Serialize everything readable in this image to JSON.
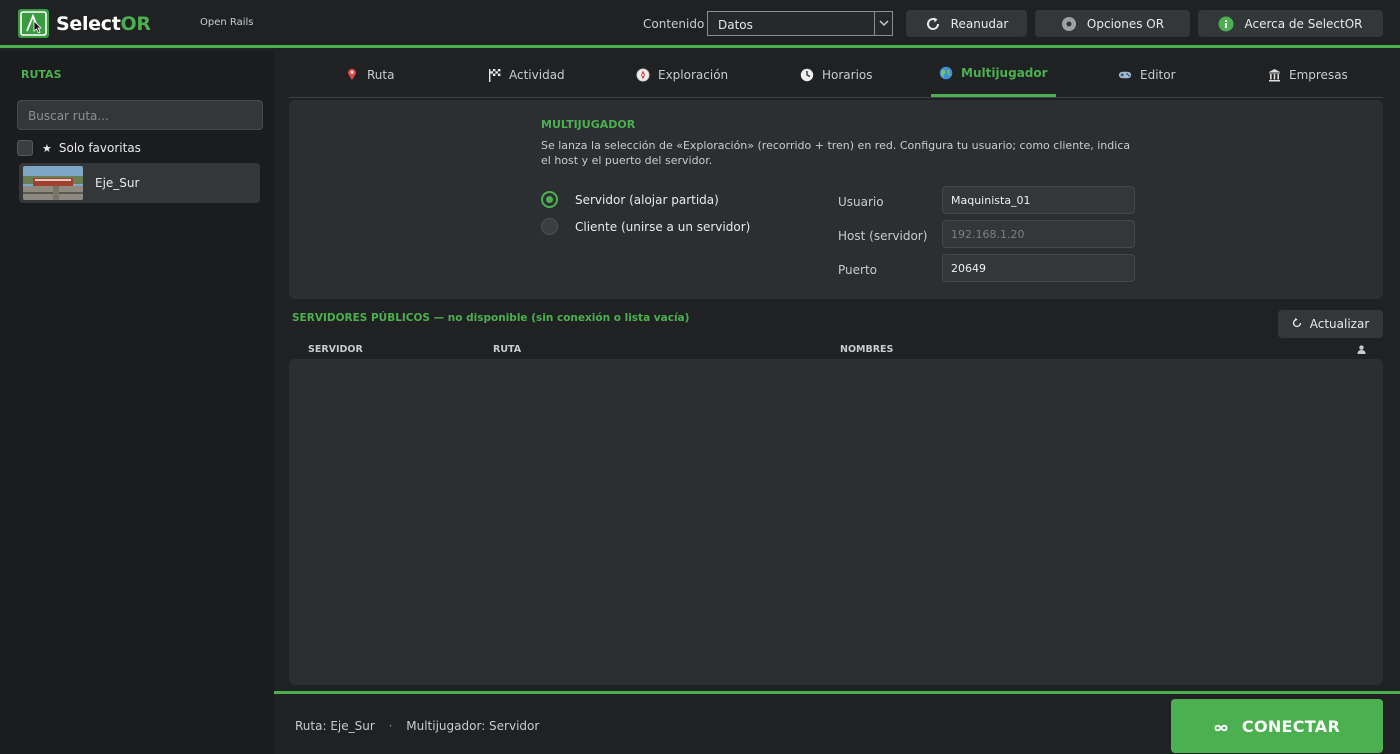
{
  "app": {
    "brand_main": "Select",
    "brand_accent": "OR",
    "subtitle": "Open Rails",
    "accent_color": "#4caf50"
  },
  "topbar": {
    "content_label": "Contenido",
    "content_value": "Datos",
    "resume_label": "Reanudar",
    "options_label": "Opciones OR",
    "about_label": "Acerca de SelectOR"
  },
  "sidebar": {
    "title": "RUTAS",
    "search_placeholder": "Buscar ruta...",
    "favorites_star": "★",
    "favorites_label": "Solo favoritas",
    "routes": [
      {
        "name": "Eje_Sur"
      }
    ]
  },
  "tabs": [
    {
      "label": "Ruta",
      "icon": "map-pin-icon"
    },
    {
      "label": "Actividad",
      "icon": "checkered-flag-icon"
    },
    {
      "label": "Exploración",
      "icon": "compass-icon"
    },
    {
      "label": "Horarios",
      "icon": "clock-icon"
    },
    {
      "label": "Multijugador",
      "icon": "globe-icon",
      "active": true
    },
    {
      "label": "Editor",
      "icon": "controller-icon"
    },
    {
      "label": "Empresas",
      "icon": "building-icon"
    }
  ],
  "multiplayer": {
    "title": "MULTIJUGADOR",
    "description": "Se lanza la selección de «Exploración» (recorrido + tren) en red. Configura tu usuario; como cliente, indica el host y el puerto del servidor.",
    "radio_server": "Servidor (alojar partida)",
    "radio_client": "Cliente (unirse a un servidor)",
    "selected_mode": "server",
    "user_label": "Usuario",
    "user_value": "Maquinista_01",
    "host_label": "Host (servidor)",
    "host_placeholder": "192.168.1.20",
    "port_label": "Puerto",
    "port_value": "20649"
  },
  "servers": {
    "title": "SERVIDORES PÚBLICOS — no disponible (sin conexión o lista vacía)",
    "refresh_label": "Actualizar",
    "columns": [
      "SERVIDOR",
      "RUTA",
      "NOMBRES"
    ],
    "rows": []
  },
  "footer": {
    "status_route": "Ruta: Eje_Sur",
    "status_sep": "·",
    "status_mode": "Multijugador: Servidor",
    "connect_label": "CONECTAR"
  }
}
